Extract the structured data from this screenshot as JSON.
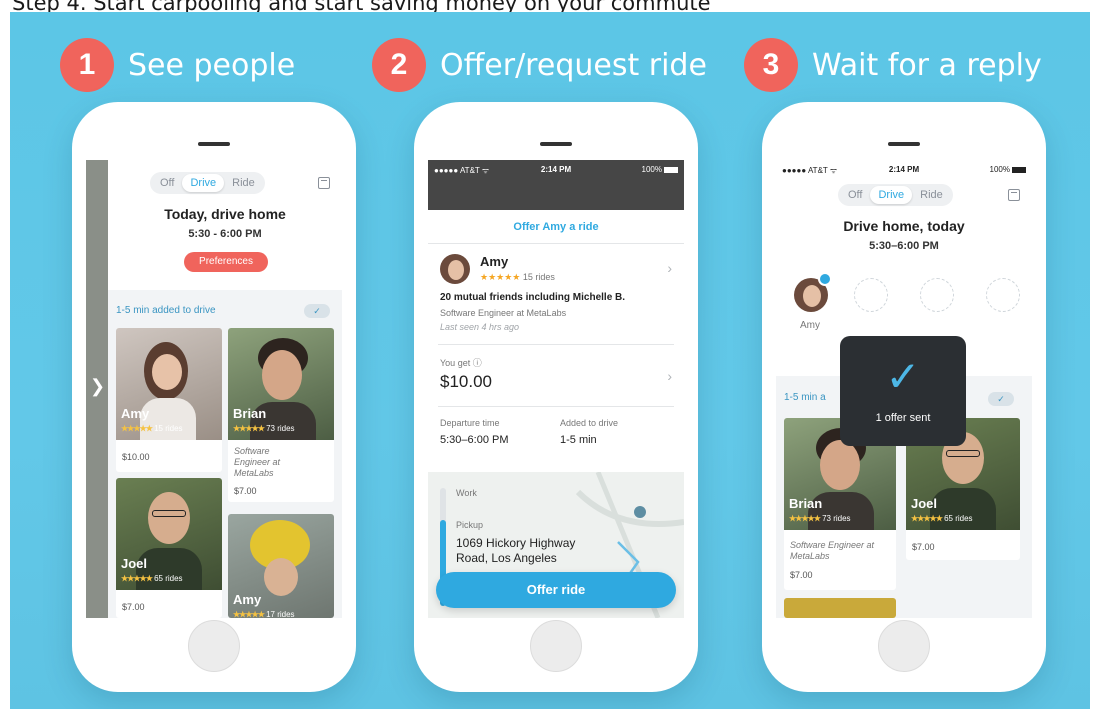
{
  "caption": "Step 4. Start carpooling and start saving money on your commute",
  "steps": [
    {
      "num": "1",
      "title": "See people"
    },
    {
      "num": "2",
      "title": "Offer/request ride"
    },
    {
      "num": "3",
      "title": "Wait for a reply"
    }
  ],
  "phone1": {
    "segment": [
      "Off",
      "Drive",
      "Ride"
    ],
    "title": "Today, drive home",
    "time": "5:30 - 6:00 PM",
    "preferences": "Preferences",
    "bar_text": "1-5 min added to drive",
    "check": "✓",
    "cards": [
      {
        "name": "Amy",
        "rides": "15 rides",
        "price": "$10.00"
      },
      {
        "name": "Brian",
        "rides": "73 rides",
        "sub": "Software Engineer at MetaLabs",
        "price": "$7.00"
      },
      {
        "name": "Joel",
        "rides": "65 rides",
        "price": "$7.00"
      },
      {
        "name": "Amy",
        "rides": "17 rides"
      }
    ],
    "stars": "★★★★★"
  },
  "phone2": {
    "status": {
      "carrier": "●●●●● AT&T ᯤ",
      "time": "2:14 PM",
      "battery": "100%"
    },
    "header": "Offer Amy a ride",
    "name": "Amy",
    "stars": "★★★★★",
    "rides": "15 rides",
    "mutual": "20 mutual friends including Michelle B.",
    "job": "Software Engineer at MetaLabs",
    "last_seen": "Last seen 4 hrs ago",
    "you_get_label": "You get ⓘ",
    "you_get_value": "$10.00",
    "departure_label": "Departure time",
    "departure_value": "5:30–6:00 PM",
    "added_label": "Added to drive",
    "added_value": "1-5 min",
    "route_work": "Work",
    "route_pickup": "Pickup",
    "pickup_address": "1069 Hickory Highway Road, Los Angeles",
    "offer_button": "Offer ride"
  },
  "phone3": {
    "status": {
      "carrier": "●●●●● AT&T ᯤ",
      "time": "2:14 PM",
      "battery": "100%"
    },
    "segment": [
      "Off",
      "Drive",
      "Ride"
    ],
    "title": "Drive home, today",
    "time": "5:30–6:00 PM",
    "rider": "Amy",
    "bar_text": "1-5 min a",
    "check": "✓",
    "toast_text": "1 offer sent",
    "cards": [
      {
        "name": "Brian",
        "rides": "73 rides",
        "sub": "Software Engineer at MetaLabs",
        "price": "$7.00"
      },
      {
        "name": "Joel",
        "rides": "65 rides",
        "price": "$7.00"
      }
    ],
    "stars": "★★★★★"
  }
}
